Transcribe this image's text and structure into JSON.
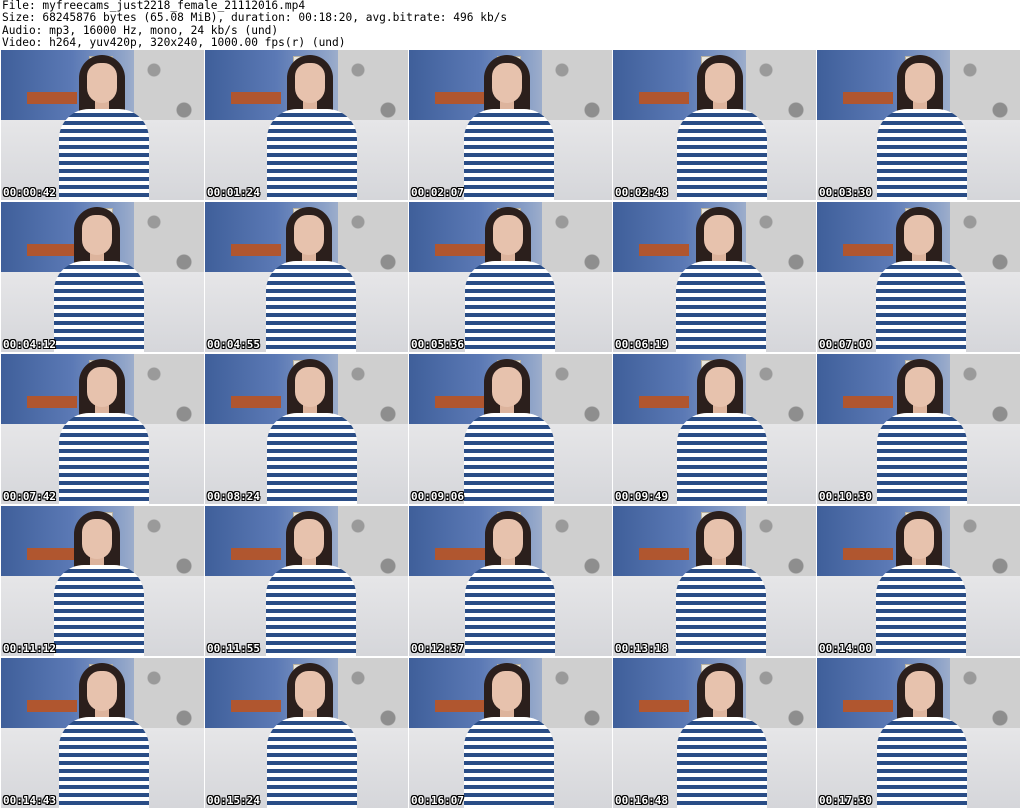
{
  "header": {
    "file_line": "File: myfreecams_just2218_female_21112016.mp4",
    "size_line": "Size: 68245876 bytes (65.08 MiB), duration: 00:18:20, avg.bitrate: 496 kb/s",
    "audio_line": "Audio: mp3, 16000 Hz, mono, 24 kb/s (und)",
    "video_line": "Video: h264, yuv420p, 320x240, 1000.00 fps(r) (und)"
  },
  "thumbnails": [
    {
      "timestamp": "00:00:42"
    },
    {
      "timestamp": "00:01:24"
    },
    {
      "timestamp": "00:02:07"
    },
    {
      "timestamp": "00:02:48"
    },
    {
      "timestamp": "00:03:30"
    },
    {
      "timestamp": "00:04:12"
    },
    {
      "timestamp": "00:04:55"
    },
    {
      "timestamp": "00:05:36"
    },
    {
      "timestamp": "00:06:19"
    },
    {
      "timestamp": "00:07:00"
    },
    {
      "timestamp": "00:07:42"
    },
    {
      "timestamp": "00:08:24"
    },
    {
      "timestamp": "00:09:06"
    },
    {
      "timestamp": "00:09:49"
    },
    {
      "timestamp": "00:10:30"
    },
    {
      "timestamp": "00:11:12"
    },
    {
      "timestamp": "00:11:55"
    },
    {
      "timestamp": "00:12:37"
    },
    {
      "timestamp": "00:13:18"
    },
    {
      "timestamp": "00:14:00"
    },
    {
      "timestamp": "00:14:43"
    },
    {
      "timestamp": "00:15:24"
    },
    {
      "timestamp": "00:16:07"
    },
    {
      "timestamp": "00:16:48"
    },
    {
      "timestamp": "00:17:30"
    }
  ]
}
